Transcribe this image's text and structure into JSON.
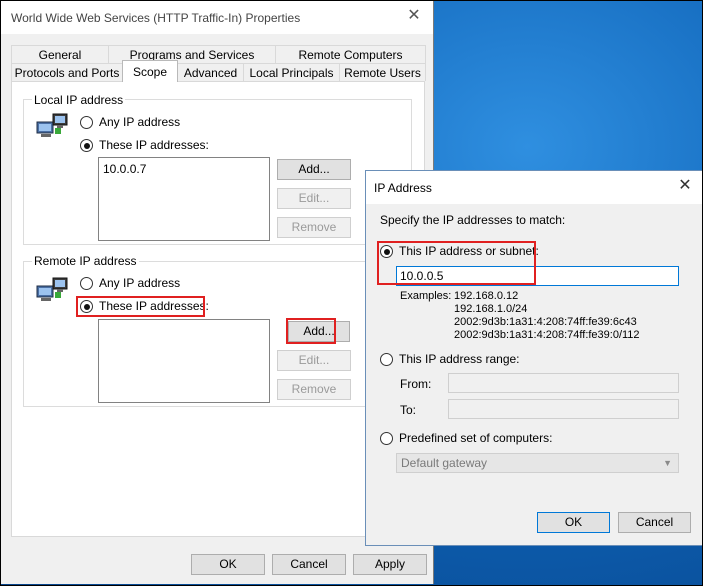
{
  "props_dialog": {
    "title": "World Wide Web Services (HTTP Traffic-In) Properties",
    "tabs_row1": [
      "General",
      "Programs and Services",
      "Remote Computers"
    ],
    "tabs_row2": [
      "Protocols and Ports",
      "Scope",
      "Advanced",
      "Local Principals",
      "Remote Users"
    ],
    "active_tab": "Scope",
    "local_ip": {
      "group_label": "Local IP address",
      "any_label": "Any IP address",
      "these_label": "These IP addresses:",
      "selected": "these",
      "addresses": [
        "10.0.0.7"
      ],
      "add": "Add...",
      "edit": "Edit...",
      "remove": "Remove"
    },
    "remote_ip": {
      "group_label": "Remote IP address",
      "any_label": "Any IP address",
      "these_label": "These IP addresses:",
      "selected": "these",
      "addresses": [],
      "add": "Add...",
      "edit": "Edit...",
      "remove": "Remove"
    },
    "footer": {
      "ok": "OK",
      "cancel": "Cancel",
      "apply": "Apply"
    }
  },
  "ip_dialog": {
    "title": "IP Address",
    "instruction": "Specify the IP addresses to match:",
    "option_subnet": "This IP address or subnet:",
    "subnet_value": "10.0.0.5",
    "examples_label": "Examples:",
    "examples": [
      "192.168.0.12",
      "192.168.1.0/24",
      "2002:9d3b:1a31:4:208:74ff:fe39:6c43",
      "2002:9d3b:1a31:4:208:74ff:fe39:0/112"
    ],
    "option_range": "This IP address range:",
    "from_label": "From:",
    "to_label": "To:",
    "option_predefined": "Predefined set of computers:",
    "predefined_value": "Default gateway",
    "selected": "subnet",
    "ok": "OK",
    "cancel": "Cancel"
  },
  "colors": {
    "highlight": "#e02020",
    "focus": "#0078d7",
    "desktop": "#0f64b8"
  }
}
